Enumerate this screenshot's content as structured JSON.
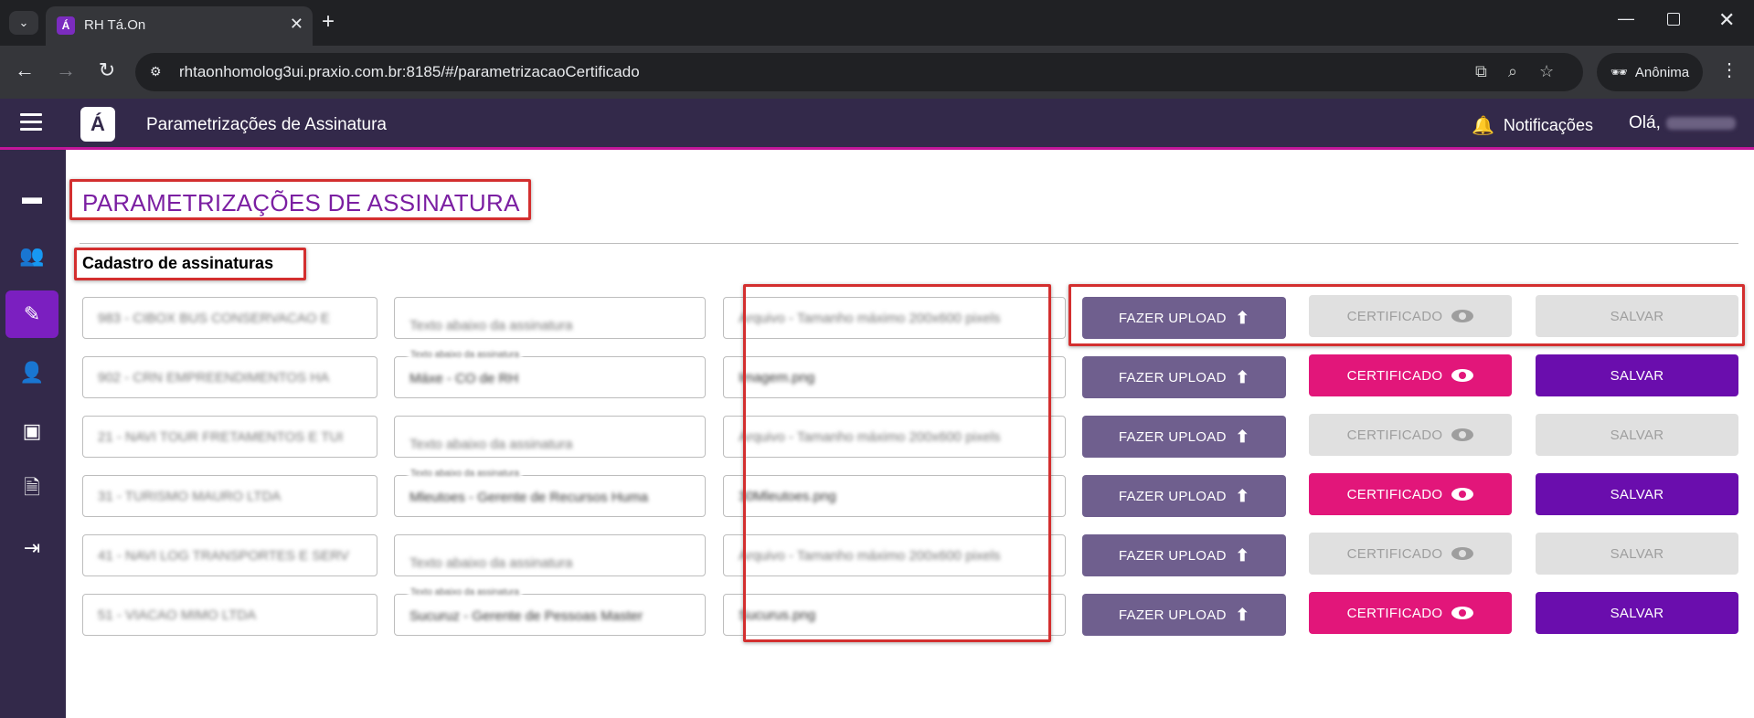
{
  "browser": {
    "tab_title": "RH Tá.On",
    "tab_favicon": "Á",
    "url": "rhtaonhomolog3ui.praxio.com.br:8185/#/parametrizacaoCertificado",
    "incognito_label": "Anônima"
  },
  "header": {
    "logo": "Á",
    "title": "Parametrizações de Assinatura",
    "notifications_label": "Notificações",
    "greeting": "Olá,"
  },
  "sidebar": {
    "items": [
      {
        "icon": "chat-icon",
        "glyph": "▬"
      },
      {
        "icon": "users-search-icon",
        "glyph": "👥"
      },
      {
        "icon": "edit-icon",
        "glyph": "✎"
      },
      {
        "icon": "add-user-icon",
        "glyph": "👤"
      },
      {
        "icon": "badge-icon",
        "glyph": "▣"
      },
      {
        "icon": "document-icon",
        "glyph": "🗎"
      },
      {
        "icon": "logout-icon",
        "glyph": "⇥"
      }
    ]
  },
  "main": {
    "page_title": "PARAMETRIZAÇÕES DE ASSINATURA",
    "section_title": "Cadastro de assinaturas",
    "field_label": "Texto abaixo da assinatura",
    "buttons": {
      "upload": "FAZER UPLOAD",
      "certificate": "CERTIFICADO",
      "save": "SALVAR"
    },
    "rows": [
      {
        "company": "983 - CIBOX BUS CONSERVACAO E",
        "signature_text": "Texto abaixo da assinatura",
        "signature_filled": false,
        "file": "Arquivo - Tamanho máximo 200x600 pixels",
        "file_filled": false,
        "enabled": false
      },
      {
        "company": "902 - CRN EMPREENDIMENTOS HA",
        "signature_text": "Máxe - CO de RH",
        "signature_filled": true,
        "file": "Imagem.png",
        "file_filled": true,
        "enabled": true
      },
      {
        "company": "21 - NAVI TOUR FRETAMENTOS E TUI",
        "signature_text": "Texto abaixo da assinatura",
        "signature_filled": false,
        "file": "Arquivo - Tamanho máximo 200x600 pixels",
        "file_filled": false,
        "enabled": false
      },
      {
        "company": "31 - TURISMO MAURO LTDA",
        "signature_text": "Mleutoes - Gerente de Recursos Huma",
        "signature_filled": true,
        "file": "30Mleutoes.png",
        "file_filled": true,
        "enabled": true
      },
      {
        "company": "41 - NAVI LOG TRANSPORTES E SERV",
        "signature_text": "Texto abaixo da assinatura",
        "signature_filled": false,
        "file": "Arquivo - Tamanho máximo 200x600 pixels",
        "file_filled": false,
        "enabled": false
      },
      {
        "company": "51 - VIACAO MIMO LTDA",
        "signature_text": "Sucuruz - Gerente de Pessoas Master",
        "signature_filled": true,
        "file": "Sucurus.png",
        "file_filled": true,
        "enabled": true
      }
    ]
  },
  "colors": {
    "header_bg": "#33294a",
    "accent_pink": "#e2167a",
    "accent_purple": "#6a0dad",
    "upload_btn": "#6f5f8e",
    "title_purple": "#7b1fa2",
    "highlight_red": "#d32f2f"
  }
}
